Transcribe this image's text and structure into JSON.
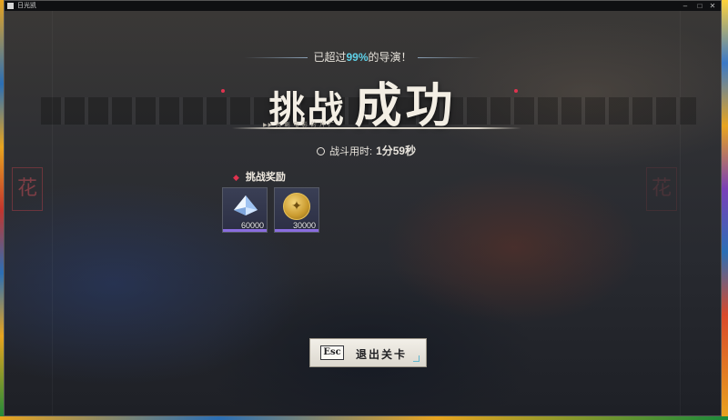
{
  "window": {
    "title": "日光凯",
    "controls": {
      "minimize": "–",
      "maximize": "□",
      "close": "✕"
    }
  },
  "banner": {
    "prefix": "已超过",
    "percent": "99%",
    "suffix": "的导演！"
  },
  "headline": {
    "part1": "挑战",
    "part2": "成功",
    "sub": "▶▶ 大 剧 电 影 的 片 厂"
  },
  "duration": {
    "label": "战斗用时:",
    "value": "1分59秒"
  },
  "rewards": {
    "title": "挑战奖励",
    "items": [
      {
        "icon": "crystal-icon",
        "quantity": "60000"
      },
      {
        "icon": "gold-coin-icon",
        "quantity": "30000"
      }
    ]
  },
  "exit_button": {
    "key": "Esc",
    "label": "退出关卡"
  },
  "colors": {
    "accent_cyan": "#5fd1e8",
    "accent_red": "#e0334f",
    "rarity_purple": "#8a6de0",
    "gold": "#c99a2e"
  }
}
